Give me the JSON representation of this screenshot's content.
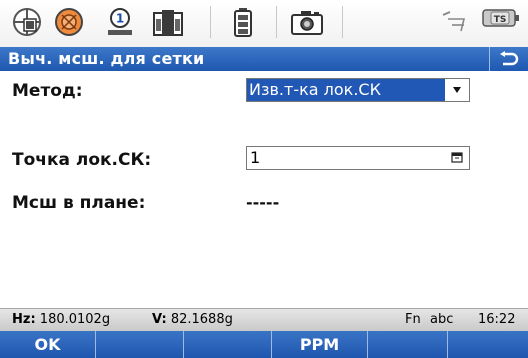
{
  "title": "Выч. мсш. для сетки",
  "icons": [
    {
      "name": "measure-mode-icon"
    },
    {
      "name": "prism-icon"
    },
    {
      "name": "target-icon"
    },
    {
      "name": "compensator-icon"
    },
    {
      "name": "battery-icon"
    },
    {
      "name": "camera-icon"
    },
    {
      "name": "line-tool-icon"
    },
    {
      "name": "ts-icon",
      "label": "TS"
    }
  ],
  "form": {
    "method_label": "Метод:",
    "method_value": "Изв.т-ка лок.СК",
    "point_label": "Точка лок.СК:",
    "point_value": "1",
    "scale_label": "Мсш в плане:",
    "scale_value": "-----"
  },
  "status": {
    "hz_label": "Hz:",
    "hz_value": "180.0102g",
    "v_label": "V:",
    "v_value": "82.1688g",
    "fn": "Fn",
    "input_mode": "abc",
    "time": "16:22"
  },
  "softkeys": [
    "OK",
    "",
    "",
    "PPM",
    "",
    ""
  ],
  "colors": {
    "title_bar": "#2a63ba",
    "selection": "#2157b5",
    "softkey_bar": "#2a63ba"
  }
}
